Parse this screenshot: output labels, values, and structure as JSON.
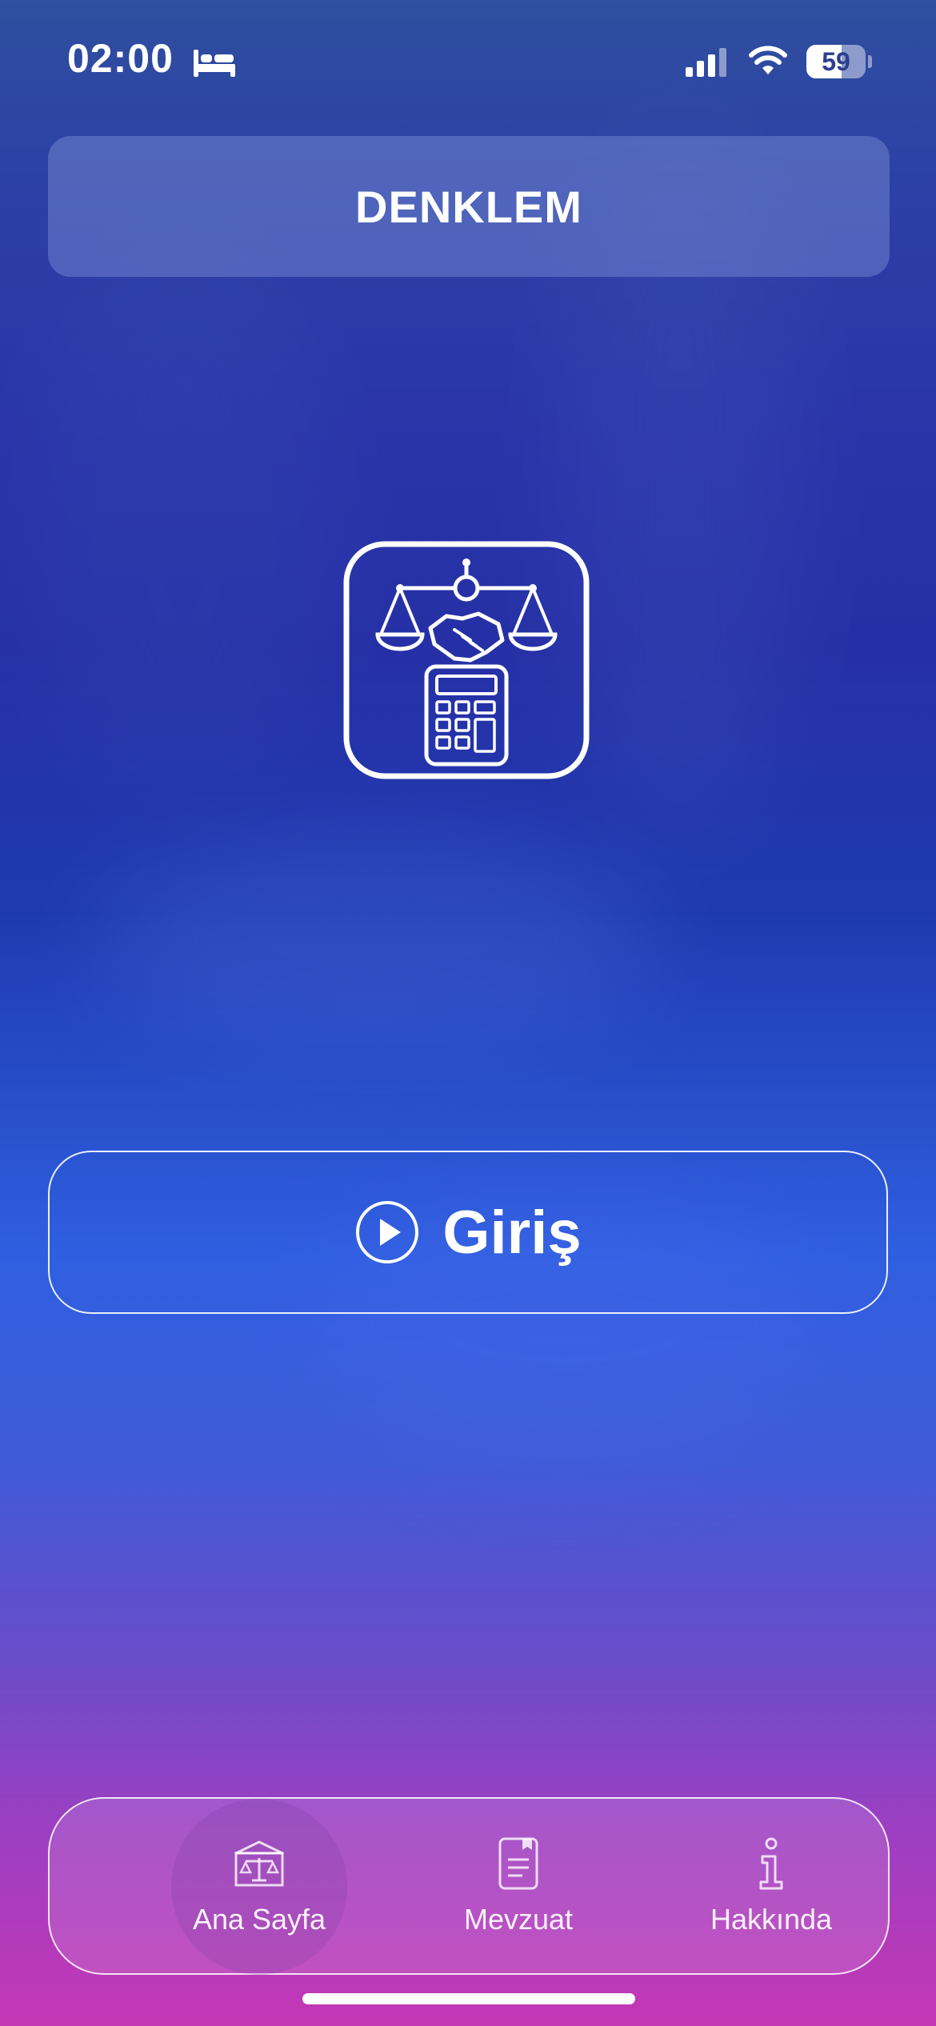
{
  "status_bar": {
    "time": "02:00",
    "battery": "59",
    "battery_level_percent": 59
  },
  "header": {
    "title": "DENKLEM"
  },
  "main": {
    "logo_icon": "scales-handshake-calculator-icon",
    "enter_button_label": "Giriş",
    "enter_button_icon": "play-circle-icon"
  },
  "tab_bar": {
    "items": [
      {
        "label": "Ana Sayfa",
        "icon": "courthouse-icon",
        "active": true
      },
      {
        "label": "Mevzuat",
        "icon": "document-icon",
        "active": false
      },
      {
        "label": "Hakkında",
        "icon": "info-icon",
        "active": false
      }
    ]
  }
}
